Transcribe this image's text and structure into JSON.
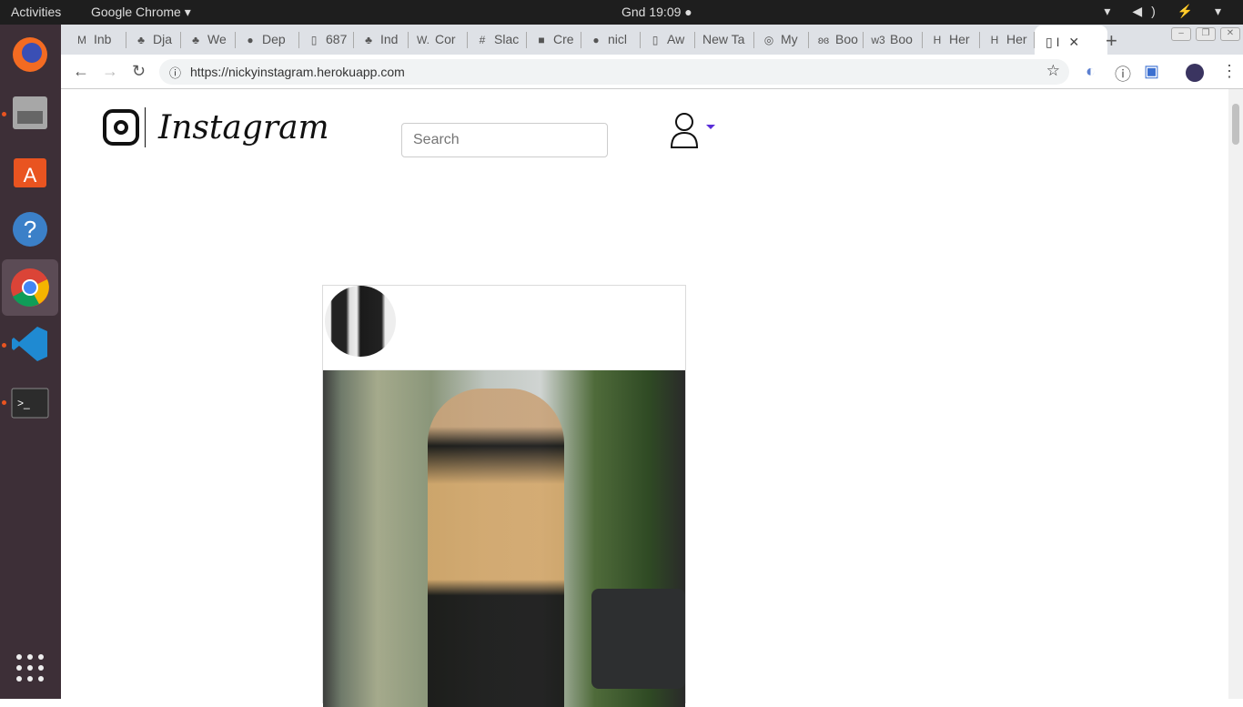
{
  "system": {
    "activities": "Activities",
    "app_name": "Google Chrome ▾",
    "clock": "Gnd 19:09 ●",
    "tray": "▾ ◀) ⚡ ▾"
  },
  "dock": [
    "firefox",
    "files",
    "software-center",
    "help",
    "chrome",
    "vscode",
    "terminal",
    "apps-grid"
  ],
  "tabs": [
    {
      "icon": "M",
      "label": "Inb"
    },
    {
      "icon": "♣",
      "label": "Dja"
    },
    {
      "icon": "♣",
      "label": "We"
    },
    {
      "icon": "●",
      "label": "Dep"
    },
    {
      "icon": "▯",
      "label": "687"
    },
    {
      "icon": "♣",
      "label": "Ind"
    },
    {
      "icon": "W.",
      "label": "Cor"
    },
    {
      "icon": "#",
      "label": "Slac"
    },
    {
      "icon": "■",
      "label": "Cre"
    },
    {
      "icon": "●",
      "label": "nicl"
    },
    {
      "icon": "▯",
      "label": "Aw"
    },
    {
      "icon": "",
      "label": "New Ta"
    },
    {
      "icon": "◎",
      "label": "My"
    },
    {
      "icon": "ʚɞ",
      "label": "Boo"
    },
    {
      "icon": "w3",
      "label": "Boo"
    },
    {
      "icon": "H",
      "label": "Her"
    },
    {
      "icon": "H",
      "label": "Her"
    }
  ],
  "active_tab": {
    "label": "I",
    "close": "✕"
  },
  "new_tab": "+",
  "url": "https://nickyinstagram.herokuapp.com",
  "page": {
    "logo_text": "Instagram",
    "search_placeholder": "Search"
  }
}
